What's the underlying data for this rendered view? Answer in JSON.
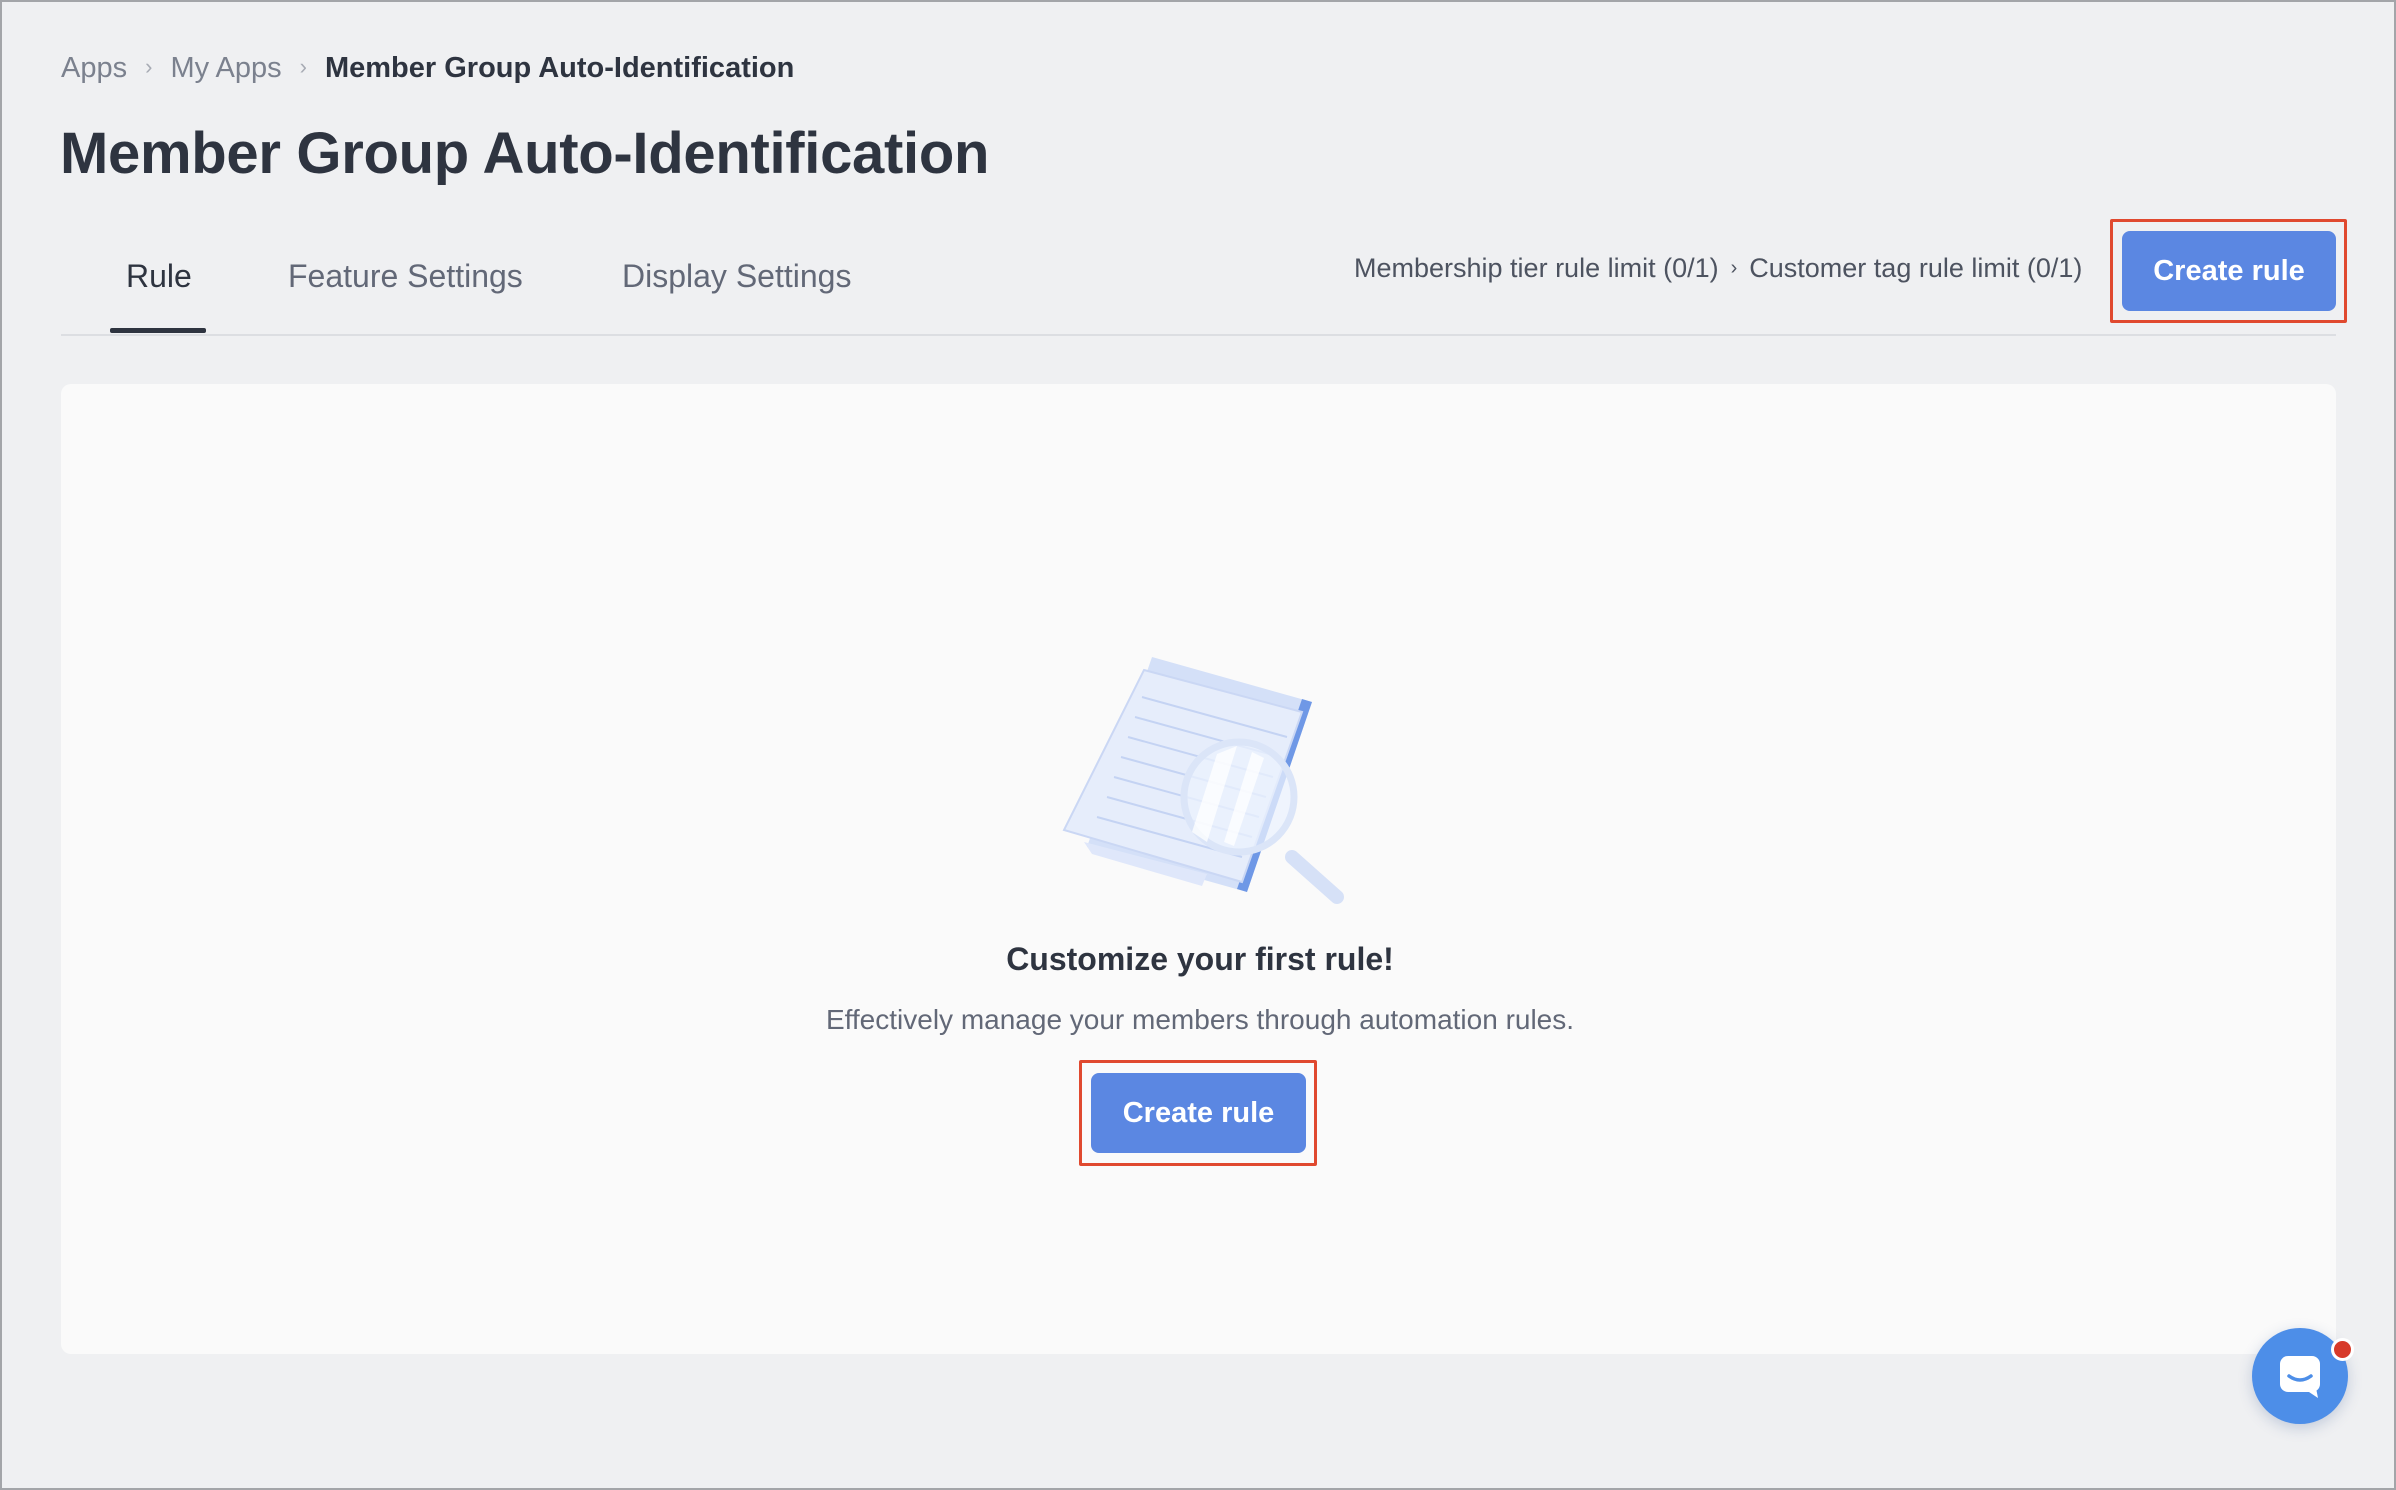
{
  "breadcrumb": {
    "items": [
      "Apps",
      "My Apps"
    ],
    "current": "Member Group Auto-Identification",
    "separator": "›"
  },
  "page": {
    "title": "Member Group Auto-Identification"
  },
  "tabs": [
    {
      "label": "Rule",
      "active": true
    },
    {
      "label": "Feature Settings",
      "active": false
    },
    {
      "label": "Display Settings",
      "active": false
    }
  ],
  "limits": {
    "membership_tier": "Membership tier rule limit (0/1)",
    "separator": "›",
    "customer_tag": "Customer tag rule limit (0/1)"
  },
  "toolbar": {
    "create_label": "Create rule"
  },
  "empty_state": {
    "title": "Customize your first rule!",
    "subtitle": "Effectively manage your members through automation rules.",
    "create_label": "Create rule",
    "illustration": "document-magnifier-icon"
  },
  "chat": {
    "icon": "chat-icon",
    "has_notification": true
  },
  "colors": {
    "accent": "#5b87e2",
    "highlight": "#e0492f",
    "chat": "#4d8ee8",
    "notification": "#d73a2a"
  }
}
